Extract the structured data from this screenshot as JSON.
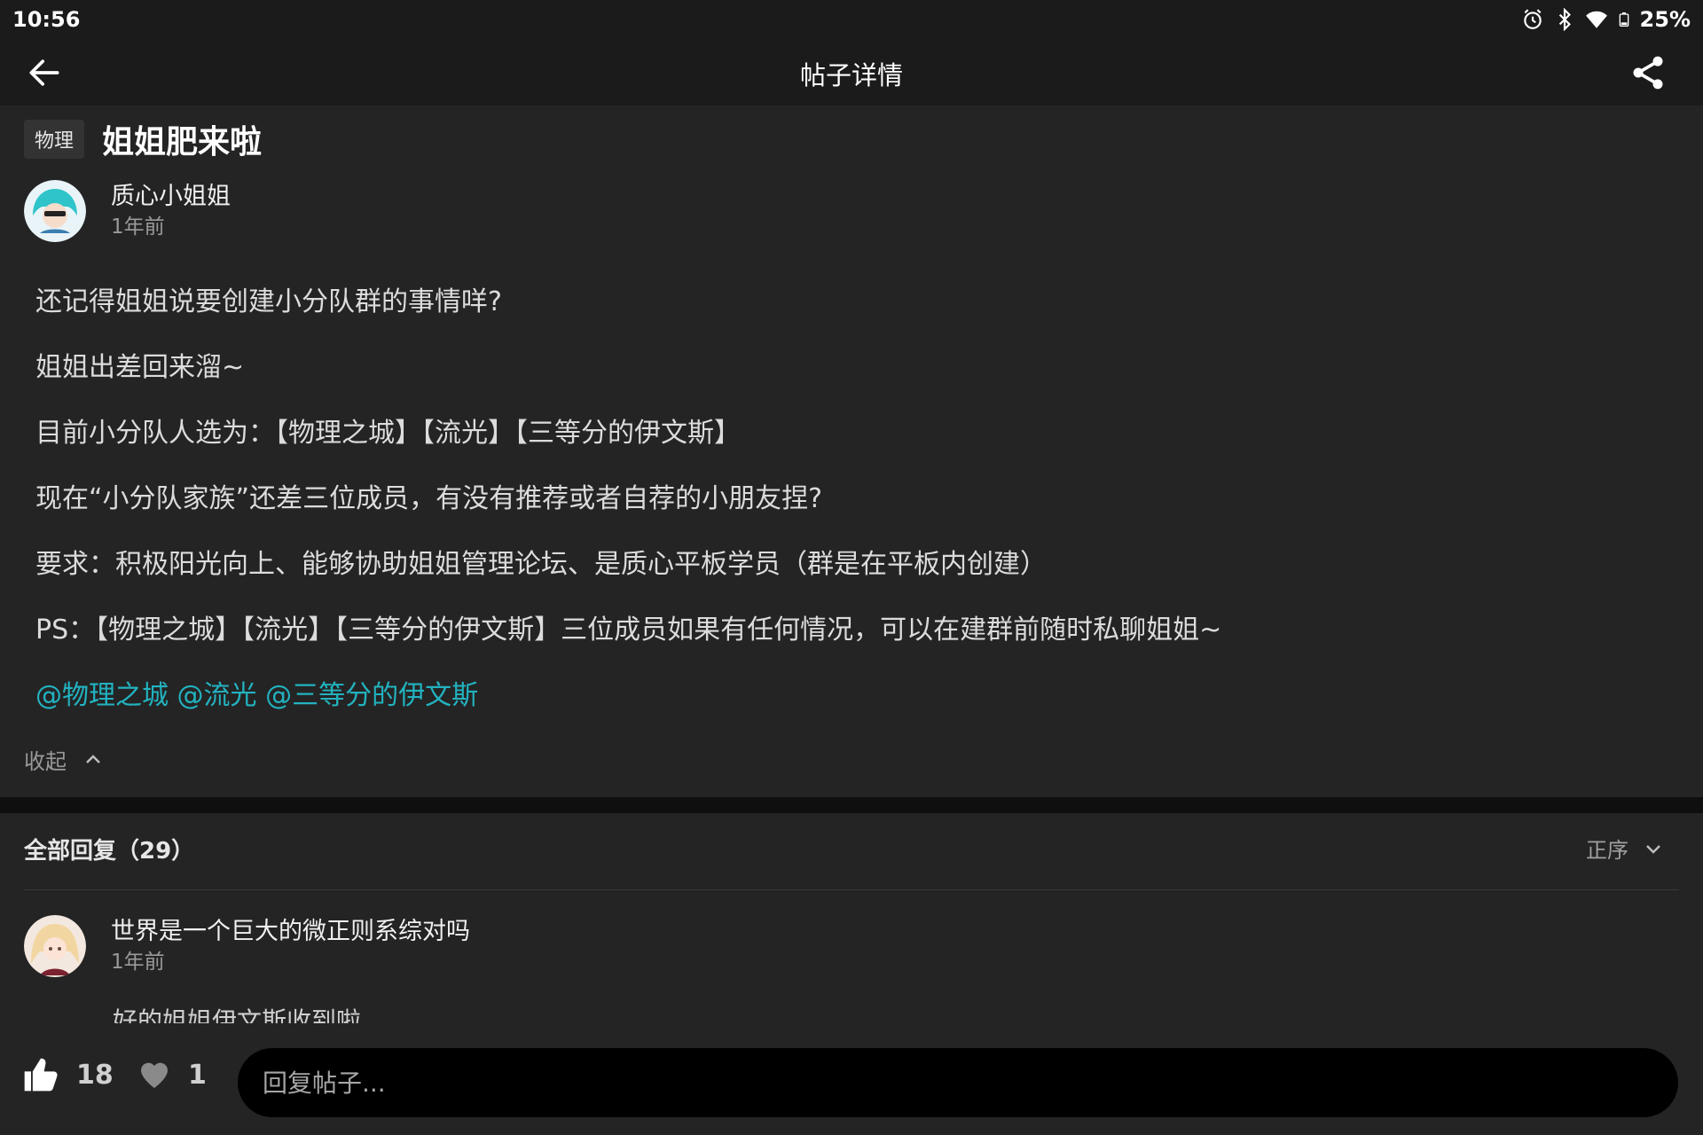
{
  "status_bar": {
    "time": "10:56",
    "battery": "25%",
    "icons": [
      "alarm-icon",
      "bluetooth-icon",
      "wifi-icon",
      "battery-icon"
    ]
  },
  "app_bar": {
    "title": "帖子详情",
    "back_icon": "arrow-left-icon",
    "share_icon": "share-icon"
  },
  "post": {
    "category": "物理",
    "title": "姐姐肥来啦",
    "author": {
      "name": "质心小姐姐",
      "time": "1年前"
    },
    "paragraphs": [
      "还记得姐姐说要创建小分队群的事情咩?",
      "姐姐出差回来溜~",
      "目前小分队人选为：【物理之城】【流光】【三等分的伊文斯】",
      "现在“小分队家族”还差三位成员，有没有推荐或者自荐的小朋友捏?",
      "要求：积极阳光向上、能够协助姐姐管理论坛、是质心平板学员（群是在平板内创建）",
      "PS：【物理之城】【流光】【三等分的伊文斯】三位成员如果有任何情况，可以在建群前随时私聊姐姐~"
    ],
    "mentions": "@物理之城 @流光 @三等分的伊文斯",
    "collapse_label": "收起"
  },
  "replies": {
    "header": "全部回复（29）",
    "sort_label": "正序",
    "items": [
      {
        "name": "世界是一个巨大的微正则系综对吗",
        "time": "1年前",
        "text": "好的姐姐伊文斯收到啦"
      }
    ]
  },
  "bottom_bar": {
    "like_count": "18",
    "fav_count": "1",
    "reply_placeholder": "回复帖子..."
  },
  "colors": {
    "background": "#242424",
    "bar": "#1b1b1b",
    "mention": "#22b3c0",
    "muted": "#9a9a9a"
  }
}
